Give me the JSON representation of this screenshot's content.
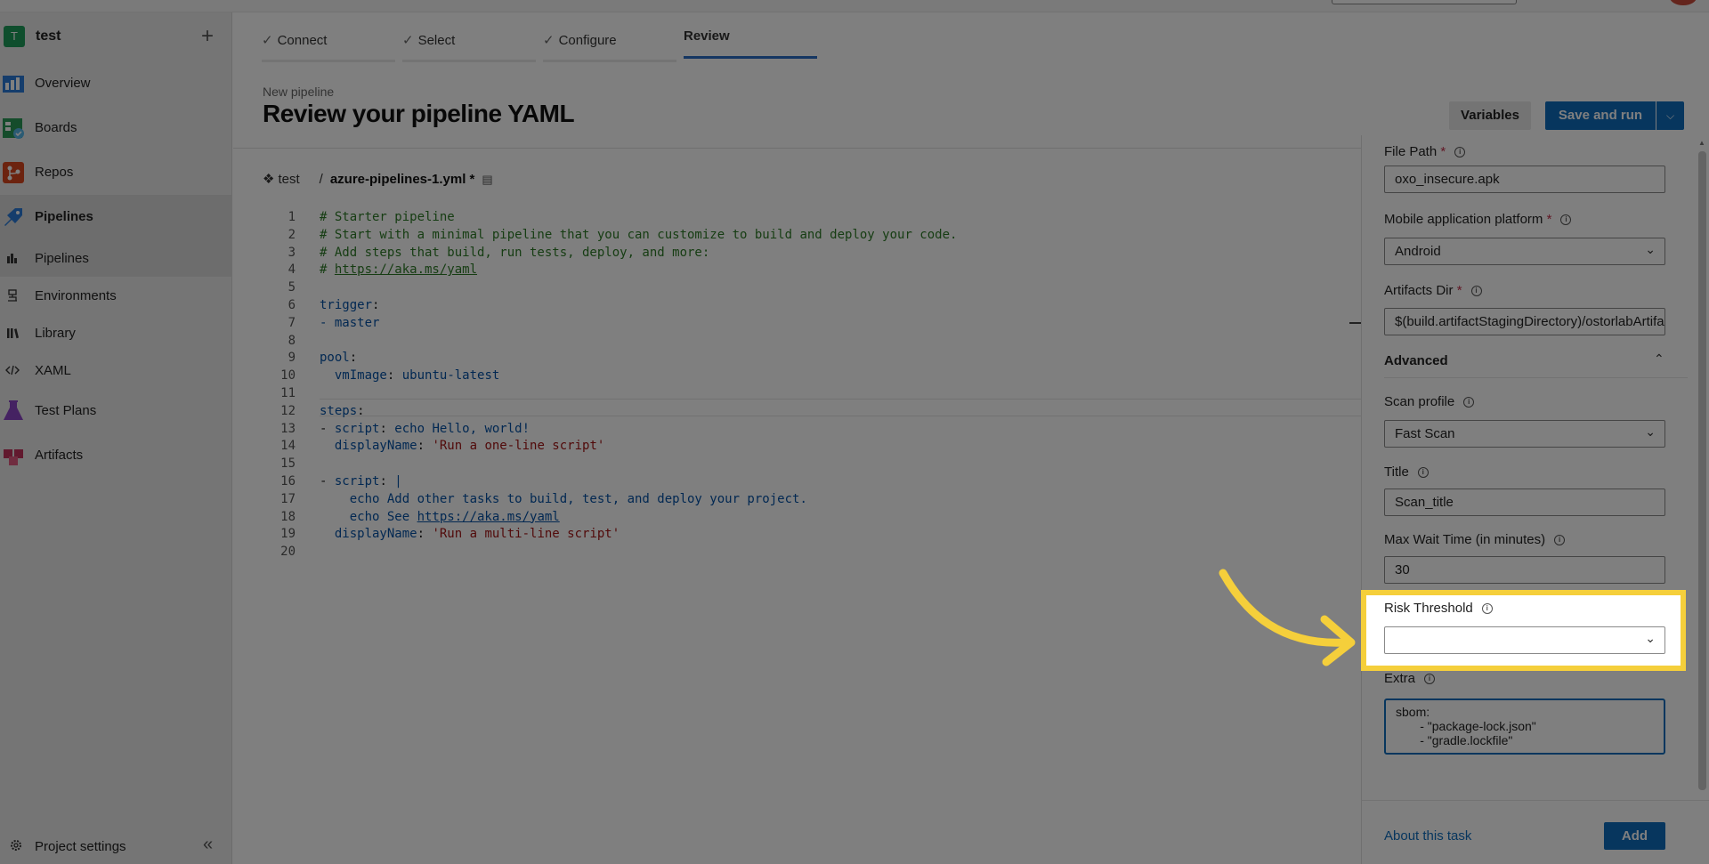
{
  "sidebar": {
    "project": {
      "initial": "T",
      "name": "test"
    },
    "nav": [
      {
        "label": "Overview"
      },
      {
        "label": "Boards"
      },
      {
        "label": "Repos"
      },
      {
        "label": "Pipelines"
      }
    ],
    "pipelines_sub": [
      {
        "label": "Pipelines"
      },
      {
        "label": "Environments"
      },
      {
        "label": "Library"
      },
      {
        "label": "XAML"
      }
    ],
    "nav_bottom": [
      {
        "label": "Test Plans"
      },
      {
        "label": "Artifacts"
      }
    ],
    "settings_label": "Project settings"
  },
  "wizard": {
    "steps": [
      {
        "label": "Connect",
        "done": true
      },
      {
        "label": "Select",
        "done": true
      },
      {
        "label": "Configure",
        "done": true
      },
      {
        "label": "Review",
        "done": false
      }
    ]
  },
  "header": {
    "small": "New pipeline",
    "title": "Review your pipeline YAML",
    "variables_label": "Variables",
    "save_label": "Save and run"
  },
  "editor": {
    "repo": "test",
    "file": "azure-pipelines-1.yml *",
    "lines": [
      "# Starter pipeline",
      "# Start with a minimal pipeline that you can customize to build and deploy your code.",
      "# Add steps that build, run tests, deploy, and more:",
      "# https://aka.ms/yaml",
      "",
      "trigger:",
      "- master",
      "",
      "pool:",
      "  vmImage: ubuntu-latest",
      "",
      "steps:",
      "- script: echo Hello, world!",
      "  displayName: 'Run a one-line script'",
      "",
      "- script: |",
      "    echo Add other tasks to build, test, and deploy your project.",
      "    echo See https://aka.ms/yaml",
      "  displayName: 'Run a multi-line script'",
      ""
    ]
  },
  "panel": {
    "file_path_label": "File Path",
    "file_path_value": "oxo_insecure.apk",
    "platform_label": "Mobile application platform",
    "platform_value": "Android",
    "artifacts_label": "Artifacts Dir",
    "artifacts_value": "$(build.artifactStagingDirectory)/ostorlabArtifacts",
    "advanced_label": "Advanced",
    "scan_profile_label": "Scan profile",
    "scan_profile_value": "Fast Scan",
    "title_label": "Title",
    "title_value": "Scan_title",
    "max_wait_label": "Max Wait Time (in minutes)",
    "max_wait_value": "30",
    "risk_label": "Risk Threshold",
    "risk_value": "",
    "extra_label": "Extra",
    "extra_value": "sbom:\n       - \"package-lock.json\"\n       - \"gradle.lockfile\"",
    "about_label": "About this task",
    "add_label": "Add"
  },
  "colors": {
    "accent": "#0f6cbd",
    "highlight": "#f5cf3b"
  }
}
